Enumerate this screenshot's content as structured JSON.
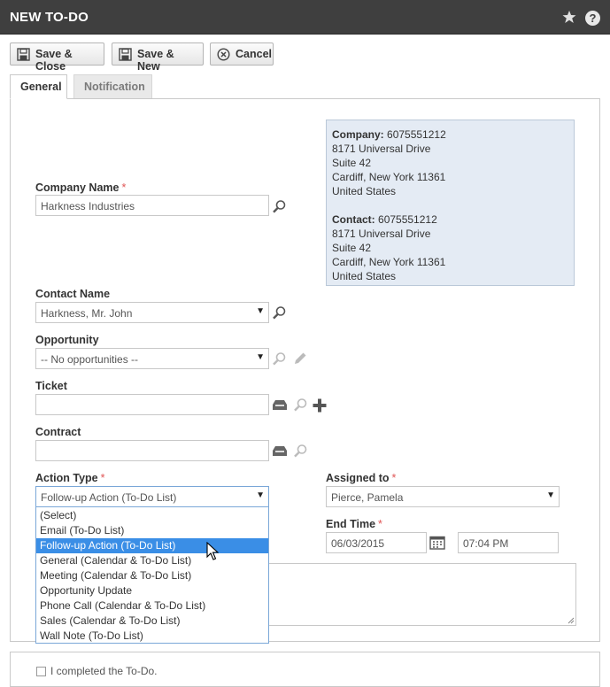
{
  "window": {
    "title": "NEW TO-DO"
  },
  "toolbar": {
    "save_close_label": "Save & Close",
    "save_new_label": "Save & New",
    "cancel_label": "Cancel"
  },
  "tabs": [
    {
      "label": "General",
      "active": true
    },
    {
      "label": "Notification",
      "active": false
    }
  ],
  "form": {
    "company_name": {
      "label": "Company Name",
      "value": "Harkness Industries",
      "required": "*"
    },
    "contact_name": {
      "label": "Contact Name",
      "value": "Harkness, Mr. John"
    },
    "opportunity": {
      "label": "Opportunity",
      "value": "-- No opportunities --"
    },
    "ticket": {
      "label": "Ticket",
      "value": ""
    },
    "contract": {
      "label": "Contract",
      "value": ""
    },
    "action_type": {
      "label": "Action Type",
      "value": "Follow-up Action (To-Do List)",
      "required": "*"
    },
    "assigned_to": {
      "label": "Assigned to",
      "value": "Pierce, Pamela",
      "required": "*"
    },
    "end_time": {
      "label": "End Time",
      "date": "06/03/2015",
      "time": "07:04 PM",
      "required": "*"
    },
    "completed_checkbox_label": "I completed the To-Do."
  },
  "address_card": {
    "company_label": "Company:",
    "company_phone": "6075551212",
    "company_lines": [
      "8171 Universal Drive",
      "Suite 42",
      "Cardiff, New York 11361",
      "United States"
    ],
    "contact_label": "Contact:",
    "contact_phone": "6075551212",
    "contact_lines": [
      "8171 Universal Drive",
      "Suite 42",
      "Cardiff, New York 11361",
      "United States"
    ]
  },
  "action_type_options": [
    "(Select)",
    "Email (To-Do List)",
    "Follow-up Action (To-Do List)",
    "General (Calendar & To-Do List)",
    "Meeting (Calendar & To-Do List)",
    "Opportunity Update",
    "Phone Call (Calendar & To-Do List)",
    "Sales (Calendar & To-Do List)",
    "Wall Note (To-Do List)"
  ],
  "action_type_selected_index": 2,
  "colors": {
    "titlebar": "#3f3f3f",
    "address_card_bg": "#e4ebf4",
    "selection": "#3a8ee6",
    "required": "#e05555"
  },
  "icons": [
    "star-icon",
    "help-icon",
    "save-icon",
    "save-new-icon",
    "cancel-icon",
    "search-icon",
    "edit-icon",
    "add-icon",
    "inbox-icon",
    "calendar-icon",
    "cursor-icon"
  ]
}
